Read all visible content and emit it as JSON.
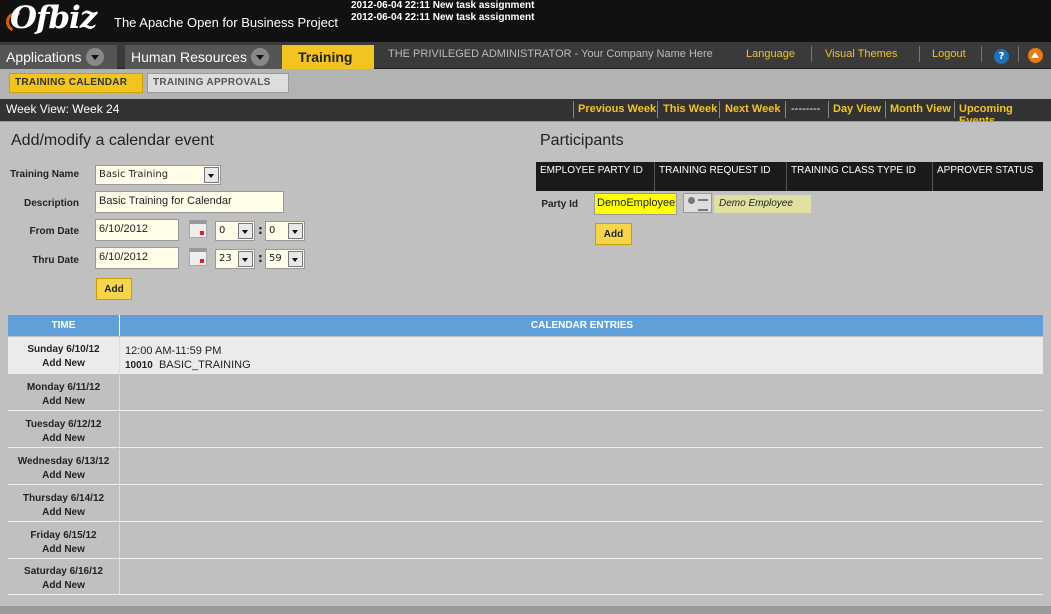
{
  "header": {
    "tagline": "The Apache Open for Business Project",
    "messages": [
      "2012-06-04 22:11 New task assignment",
      "2012-06-04 22:11 New task assignment"
    ]
  },
  "appbar": {
    "tabs": [
      {
        "label": "Applications"
      },
      {
        "label": "Human Resources"
      },
      {
        "label": "Training"
      }
    ],
    "user_line": "THE PRIVILEGED ADMINISTRATOR - Your Company Name Here",
    "links": {
      "language": "Language",
      "visual_themes": "Visual Themes",
      "logout": "Logout"
    },
    "help_icon": "?"
  },
  "subtabs": [
    {
      "label": "TRAINING CALENDAR",
      "active": true
    },
    {
      "label": "TRAINING APPROVALS",
      "active": false
    }
  ],
  "weekbar": {
    "title": "Week View: Week 24",
    "links": [
      "Previous Week",
      "This Week",
      "Next Week",
      "--------",
      "Day View",
      "Month View",
      "Upcoming Events"
    ]
  },
  "form": {
    "title": "Add/modify a calendar event",
    "training_name_label": "Training Name",
    "training_name_value": "Basic Training",
    "description_label": "Description",
    "description_value": "Basic Training for Calendar",
    "from_date_label": "From Date",
    "from_date_value": "6/10/2012",
    "from_hour": "0",
    "from_minute": "0",
    "thru_date_label": "Thru Date",
    "thru_date_value": "6/10/2012",
    "thru_hour": "23",
    "thru_minute": "59",
    "colon": ":",
    "add_label": "Add"
  },
  "participants": {
    "title": "Participants",
    "columns": [
      "EMPLOYEE PARTY ID",
      "TRAINING REQUEST ID",
      "TRAINING CLASS TYPE ID",
      "APPROVER STATUS"
    ],
    "party_id_label": "Party Id",
    "party_id_value": "DemoEmployee",
    "party_desc": "Demo Employee",
    "add_label": "Add"
  },
  "calendar": {
    "col_time": "TIME",
    "col_entries": "CALENDAR ENTRIES",
    "add_new": "Add New",
    "days": [
      {
        "day": "Sunday 6/10/12",
        "time": "12:00 AM-11:59 PM",
        "id": "10010",
        "name": "BASIC_TRAINING"
      },
      {
        "day": "Monday 6/11/12"
      },
      {
        "day": "Tuesday 6/12/12"
      },
      {
        "day": "Wednesday 6/13/12"
      },
      {
        "day": "Thursday 6/14/12"
      },
      {
        "day": "Friday 6/15/12"
      },
      {
        "day": "Saturday 6/16/12"
      }
    ]
  },
  "colors": {
    "accent": "#f2c41f",
    "header_bg": "#111111",
    "table_head": "#5fa0d8"
  }
}
